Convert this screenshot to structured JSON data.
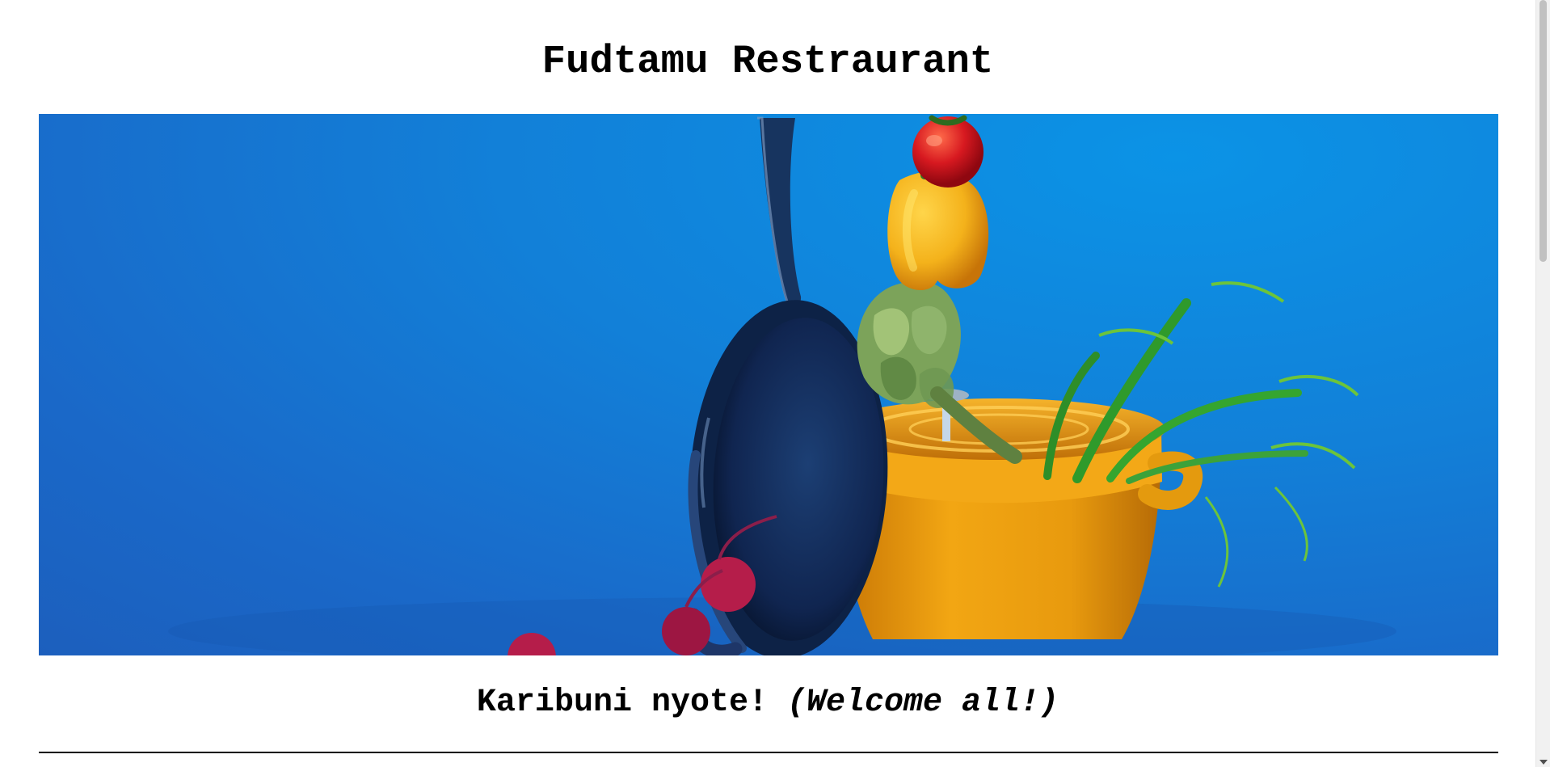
{
  "page": {
    "title": "Fudtamu Restraurant",
    "welcome_swahili": "Karibuni nyote!",
    "welcome_english": "(Welcome all!)"
  },
  "hero": {
    "description_icon": "kitchen-hero-image",
    "colors": {
      "background": "#1280d8",
      "pot": "#f0a214",
      "pan": "#13264f",
      "tomato": "#d71920",
      "pepper": "#f4b21b",
      "artichoke": "#7ca35a",
      "fennel": "#49a62d",
      "radish": "#b51d4a"
    }
  },
  "scrollbar": {
    "thumb_icon": "scrollbar-thumb",
    "down_icon": "scroll-down-arrow-icon"
  }
}
